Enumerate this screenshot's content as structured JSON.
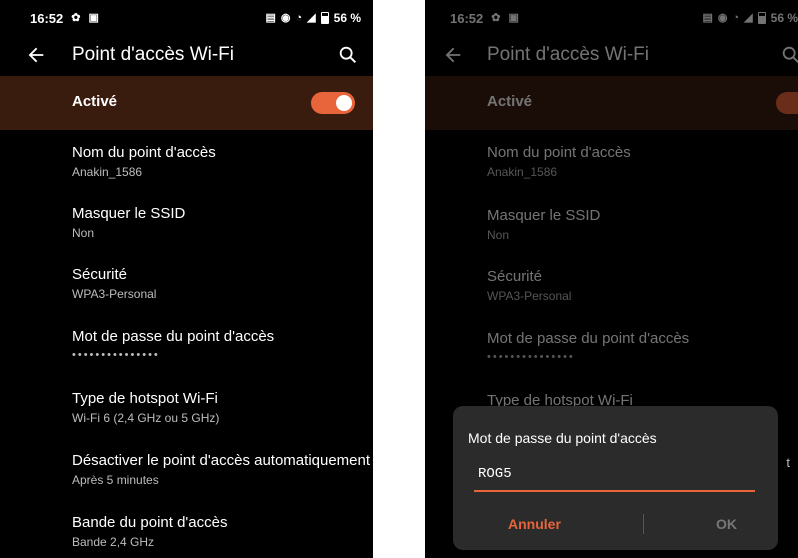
{
  "status": {
    "time": "16:52",
    "battery": "56 %"
  },
  "appbar": {
    "title": "Point d'accès Wi-Fi"
  },
  "toggle": {
    "label": "Activé",
    "on": true
  },
  "settings": [
    {
      "title": "Nom du point d'accès",
      "subtitle": "Anakin_1586"
    },
    {
      "title": "Masquer le SSID",
      "subtitle": "Non"
    },
    {
      "title": "Sécurité",
      "subtitle": "WPA3-Personal"
    },
    {
      "title": "Mot de passe du point d'accès",
      "masked": "•••••••••••••••"
    },
    {
      "title": "Type de hotspot Wi-Fi",
      "subtitle": "Wi-Fi 6 (2,4 GHz ou 5 GHz)"
    },
    {
      "title": "Désactiver le point d'accès automatiquement",
      "subtitle": "Après 5 minutes"
    },
    {
      "title": "Bande du point d'accès",
      "subtitle": "Bande 2,4 GHz"
    }
  ],
  "dialog": {
    "title": "Mot de passe du point d'accès",
    "input_value": "ROG5",
    "cancel_label": "Annuler",
    "ok_label": "OK"
  },
  "edge_letter": "t",
  "colors": {
    "accent": "#e8643a",
    "toggle_row_bg": "#3a1c0e",
    "dialog_bg": "#2b2b2b"
  },
  "icons": [
    "settings-gear-icon",
    "image-icon",
    "vibrate-icon",
    "hotspot-icon",
    "wifi-icon",
    "signal-icon",
    "battery-icon",
    "back-arrow-icon",
    "search-icon"
  ]
}
